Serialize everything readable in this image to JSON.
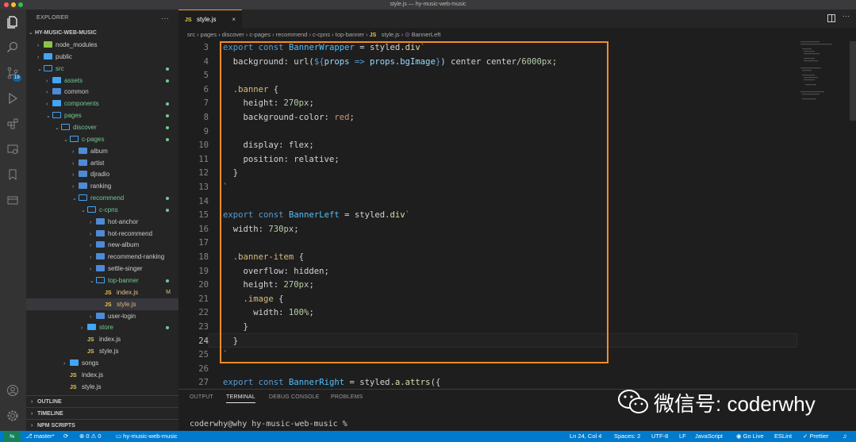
{
  "window": {
    "title": "style.js — hy-music-web-music"
  },
  "activity_bar": {
    "icons": [
      "explorer-icon",
      "search-icon",
      "source-control-icon",
      "run-debug-icon",
      "extensions-icon",
      "remote-explorer-icon",
      "bookmarks-icon",
      "docker-icon",
      "account-icon",
      "settings-gear-icon"
    ],
    "scm_badge": "19"
  },
  "explorer": {
    "header": "EXPLORER",
    "more": "···",
    "root": "HY-MUSIC-WEB-MUSIC",
    "items": [
      {
        "label": "node_modules",
        "type": "folder",
        "open": false,
        "depth": 1,
        "dot": false
      },
      {
        "label": "public",
        "type": "folder",
        "open": false,
        "depth": 1,
        "dot": false
      },
      {
        "label": "src",
        "type": "folder",
        "open": true,
        "depth": 1,
        "dot": true
      },
      {
        "label": "assets",
        "type": "folder",
        "open": false,
        "depth": 2,
        "dot": true
      },
      {
        "label": "common",
        "type": "folder",
        "open": false,
        "depth": 2,
        "dot": false
      },
      {
        "label": "components",
        "type": "folder",
        "open": false,
        "depth": 2,
        "dot": true
      },
      {
        "label": "pages",
        "type": "folder",
        "open": true,
        "depth": 2,
        "dot": true
      },
      {
        "label": "discover",
        "type": "folder",
        "open": true,
        "depth": 3,
        "dot": true
      },
      {
        "label": "c-pages",
        "type": "folder",
        "open": true,
        "depth": 4,
        "dot": true
      },
      {
        "label": "album",
        "type": "folder",
        "open": false,
        "depth": 5,
        "dot": false
      },
      {
        "label": "artist",
        "type": "folder",
        "open": false,
        "depth": 5,
        "dot": false
      },
      {
        "label": "djradio",
        "type": "folder",
        "open": false,
        "depth": 5,
        "dot": false
      },
      {
        "label": "ranking",
        "type": "folder",
        "open": false,
        "depth": 5,
        "dot": false
      },
      {
        "label": "recommend",
        "type": "folder",
        "open": true,
        "depth": 5,
        "dot": true
      },
      {
        "label": "c-cpns",
        "type": "folder",
        "open": true,
        "depth": 6,
        "dot": true
      },
      {
        "label": "hot-anchor",
        "type": "folder",
        "open": false,
        "depth": 7,
        "dot": false
      },
      {
        "label": "hot-recommend",
        "type": "folder",
        "open": false,
        "depth": 7,
        "dot": false
      },
      {
        "label": "new-album",
        "type": "folder",
        "open": false,
        "depth": 7,
        "dot": false
      },
      {
        "label": "recommend-ranking",
        "type": "folder",
        "open": false,
        "depth": 7,
        "dot": false
      },
      {
        "label": "settle-singer",
        "type": "folder",
        "open": false,
        "depth": 7,
        "dot": false
      },
      {
        "label": "top-banner",
        "type": "folder",
        "open": true,
        "depth": 7,
        "dot": true
      },
      {
        "label": "index.js",
        "type": "js",
        "depth": 8,
        "mark": "M"
      },
      {
        "label": "style.js",
        "type": "js",
        "depth": 8,
        "selected": true
      },
      {
        "label": "user-login",
        "type": "folder",
        "open": false,
        "depth": 7,
        "dot": false
      },
      {
        "label": "store",
        "type": "folder",
        "open": false,
        "depth": 6,
        "dot": true
      },
      {
        "label": "index.js",
        "type": "js",
        "depth": 6
      },
      {
        "label": "style.js",
        "type": "js",
        "depth": 6
      },
      {
        "label": "songs",
        "type": "folder",
        "open": false,
        "depth": 4,
        "dot": false
      },
      {
        "label": "index.js",
        "type": "js",
        "depth": 4
      },
      {
        "label": "style.js",
        "type": "js",
        "depth": 4
      }
    ],
    "sections": [
      "OUTLINE",
      "TIMELINE",
      "NPM SCRIPTS"
    ]
  },
  "tab": {
    "icon": "JS",
    "label": "style.js",
    "close": "×"
  },
  "breadcrumb": [
    "src",
    "pages",
    "discover",
    "c-pages",
    "recommend",
    "c-cpns",
    "top-banner",
    "style.js",
    "BannerLeft"
  ],
  "code": [
    {
      "n": "3",
      "t": [
        [
          "k",
          "export "
        ],
        [
          "k",
          "const "
        ],
        [
          "n",
          "BannerWrapper"
        ],
        [
          "d",
          " = styled."
        ],
        [
          "f",
          "div"
        ],
        [
          "s",
          "`"
        ]
      ]
    },
    {
      "n": "4",
      "t": [
        [
          "d",
          "  background: url("
        ],
        [
          "k",
          "${"
        ],
        [
          "p",
          "props"
        ],
        [
          "d",
          " "
        ],
        [
          "k",
          "=>"
        ],
        [
          "d",
          " "
        ],
        [
          "p",
          "props"
        ],
        [
          "d",
          "."
        ],
        [
          "p",
          "bgImage"
        ],
        [
          "k",
          "}"
        ],
        [
          "d",
          ") center center/"
        ],
        [
          "v",
          "6000px"
        ],
        [
          "d",
          ";"
        ]
      ]
    },
    {
      "n": "5",
      "t": []
    },
    {
      "n": "6",
      "t": [
        [
          "d",
          "  "
        ],
        [
          "sel",
          ".banner"
        ],
        [
          "d",
          " {"
        ]
      ]
    },
    {
      "n": "7",
      "t": [
        [
          "d",
          "    height: "
        ],
        [
          "v",
          "270px"
        ],
        [
          "d",
          ";"
        ]
      ]
    },
    {
      "n": "8",
      "t": [
        [
          "d",
          "    background-color: "
        ],
        [
          "s",
          "red"
        ],
        [
          "d",
          ";"
        ]
      ]
    },
    {
      "n": "9",
      "t": []
    },
    {
      "n": "10",
      "t": [
        [
          "d",
          "    display: flex;"
        ]
      ]
    },
    {
      "n": "11",
      "t": [
        [
          "d",
          "    position: relative;"
        ]
      ]
    },
    {
      "n": "12",
      "t": [
        [
          "d",
          "  }"
        ]
      ]
    },
    {
      "n": "13",
      "t": [
        [
          "s",
          "`"
        ]
      ]
    },
    {
      "n": "14",
      "t": []
    },
    {
      "n": "15",
      "t": [
        [
          "k",
          "export "
        ],
        [
          "k",
          "const "
        ],
        [
          "n",
          "BannerLeft"
        ],
        [
          "d",
          " = styled."
        ],
        [
          "f",
          "div"
        ],
        [
          "s",
          "`"
        ]
      ]
    },
    {
      "n": "16",
      "t": [
        [
          "d",
          "  width: "
        ],
        [
          "v",
          "730px"
        ],
        [
          "d",
          ";"
        ]
      ]
    },
    {
      "n": "17",
      "t": []
    },
    {
      "n": "18",
      "t": [
        [
          "d",
          "  "
        ],
        [
          "sel",
          ".banner-item"
        ],
        [
          "d",
          " {"
        ]
      ]
    },
    {
      "n": "19",
      "t": [
        [
          "d",
          "    overflow: hidden;"
        ]
      ]
    },
    {
      "n": "20",
      "t": [
        [
          "d",
          "    height: "
        ],
        [
          "v",
          "270px"
        ],
        [
          "d",
          ";"
        ]
      ]
    },
    {
      "n": "21",
      "t": [
        [
          "d",
          "    "
        ],
        [
          "sel",
          ".image"
        ],
        [
          "d",
          " {"
        ]
      ]
    },
    {
      "n": "22",
      "t": [
        [
          "d",
          "      width: "
        ],
        [
          "v",
          "100%"
        ],
        [
          "d",
          ";"
        ]
      ]
    },
    {
      "n": "23",
      "t": [
        [
          "d",
          "    }"
        ]
      ]
    },
    {
      "n": "24",
      "t": [
        [
          "d",
          "  }"
        ]
      ],
      "current": true
    },
    {
      "n": "25",
      "t": [
        [
          "s",
          "`"
        ]
      ]
    },
    {
      "n": "26",
      "t": []
    },
    {
      "n": "27",
      "t": [
        [
          "k",
          "export "
        ],
        [
          "k",
          "const "
        ],
        [
          "n",
          "BannerRight"
        ],
        [
          "d",
          " = styled."
        ],
        [
          "f",
          "a"
        ],
        [
          "d",
          "."
        ],
        [
          "f",
          "attrs"
        ],
        [
          "d",
          "({"
        ]
      ]
    }
  ],
  "panel": {
    "tabs": [
      "OUTPUT",
      "TERMINAL",
      "DEBUG CONSOLE",
      "PROBLEMS"
    ],
    "active": "TERMINAL",
    "prompt": "coderwhy@why hy-music-web-music %"
  },
  "watermark": "微信号: coderwhy",
  "status": {
    "branch": "master*",
    "sync": "⟳",
    "problems": "⊗ 0 ⚠ 0",
    "folder": "hy-music-web-music",
    "position": "Ln 24, Col 4",
    "spaces": "Spaces: 2",
    "encoding": "UTF-8",
    "eol": "LF",
    "language": "JavaScript",
    "golive": "Go Live",
    "eslint": "ESLint",
    "prettier": "✓ Prettier"
  }
}
